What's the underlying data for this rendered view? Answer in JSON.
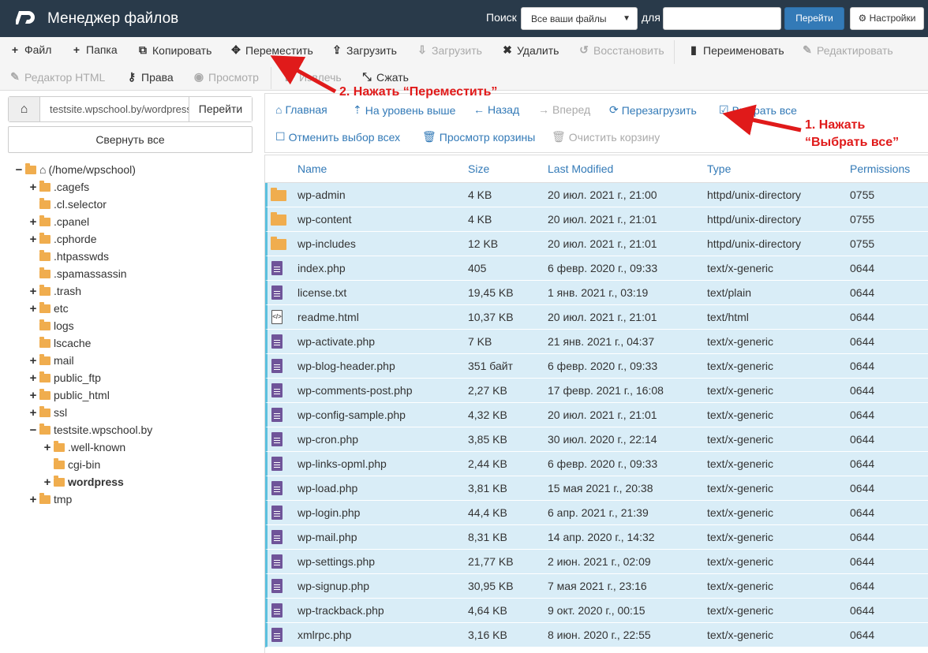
{
  "header": {
    "title": "Менеджер файлов",
    "search_label": "Поиск",
    "search_scope": "Все ваши файлы",
    "for_label": "для",
    "search_value": "",
    "go_label": "Перейти",
    "settings_label": "Настройки"
  },
  "toolbar": {
    "row1": [
      {
        "name": "file",
        "icon": "plus-icon",
        "glyph": "+",
        "label": "Файл",
        "enabled": true
      },
      {
        "name": "folder",
        "icon": "plus-icon",
        "glyph": "+",
        "label": "Папка",
        "enabled": true
      },
      {
        "name": "copy",
        "icon": "copy-icon",
        "glyph": "⧉",
        "label": "Копировать",
        "enabled": true
      },
      {
        "name": "move",
        "icon": "move-icon",
        "glyph": "✥",
        "label": "Переместить",
        "enabled": true
      },
      {
        "name": "upload",
        "icon": "upload-icon",
        "glyph": "⇪",
        "label": "Загрузить",
        "enabled": true
      },
      {
        "name": "download",
        "icon": "download-icon",
        "glyph": "⇩",
        "label": "Загрузить",
        "enabled": false
      },
      {
        "name": "delete",
        "icon": "close-icon",
        "glyph": "✖",
        "label": "Удалить",
        "enabled": true
      },
      {
        "name": "restore",
        "icon": "undo-icon",
        "glyph": "↺",
        "label": "Восстановить",
        "enabled": false
      },
      {
        "name": "rename",
        "icon": "file-icon",
        "glyph": "▮",
        "label": "Переименовать",
        "enabled": true
      },
      {
        "name": "edit",
        "icon": "pencil-icon",
        "glyph": "✎",
        "label": "Редактировать",
        "enabled": false
      }
    ],
    "row2": [
      {
        "name": "html-editor",
        "icon": "edit-icon",
        "glyph": "✎",
        "label": "Редактор HTML",
        "enabled": false
      },
      {
        "name": "permissions",
        "icon": "key-icon",
        "glyph": "⚷",
        "label": "Права",
        "enabled": true
      },
      {
        "name": "view",
        "icon": "eye-icon",
        "glyph": "◉",
        "label": "Просмотр",
        "enabled": false
      },
      {
        "name": "extract",
        "icon": "expand-icon",
        "glyph": "⤢",
        "label": "Извлечь",
        "enabled": false
      },
      {
        "name": "compress",
        "icon": "compress-icon",
        "glyph": "⤡",
        "label": "Сжать",
        "enabled": true
      }
    ]
  },
  "left": {
    "path_value": "testsite.wpschool.by/wordpress",
    "path_go": "Перейти",
    "collapse_label": "Свернуть все",
    "tree": [
      {
        "toggle": "−",
        "label": "(/home/wpschool)",
        "home": true,
        "indent": 0,
        "open": true
      },
      {
        "toggle": "+",
        "label": ".cagefs",
        "indent": 1
      },
      {
        "toggle": "",
        "label": ".cl.selector",
        "indent": 1
      },
      {
        "toggle": "+",
        "label": ".cpanel",
        "indent": 1
      },
      {
        "toggle": "+",
        "label": ".cphorde",
        "indent": 1
      },
      {
        "toggle": "",
        "label": ".htpasswds",
        "indent": 1
      },
      {
        "toggle": "",
        "label": ".spamassassin",
        "indent": 1
      },
      {
        "toggle": "+",
        "label": ".trash",
        "indent": 1
      },
      {
        "toggle": "+",
        "label": "etc",
        "indent": 1
      },
      {
        "toggle": "",
        "label": "logs",
        "indent": 1
      },
      {
        "toggle": "",
        "label": "lscache",
        "indent": 1
      },
      {
        "toggle": "+",
        "label": "mail",
        "indent": 1
      },
      {
        "toggle": "+",
        "label": "public_ftp",
        "indent": 1
      },
      {
        "toggle": "+",
        "label": "public_html",
        "indent": 1
      },
      {
        "toggle": "+",
        "label": "ssl",
        "indent": 1
      },
      {
        "toggle": "−",
        "label": "testsite.wpschool.by",
        "indent": 1,
        "open": true
      },
      {
        "toggle": "+",
        "label": ".well-known",
        "indent": 2
      },
      {
        "toggle": "",
        "label": "cgi-bin",
        "indent": 2
      },
      {
        "toggle": "+",
        "label": "wordpress",
        "indent": 2,
        "bold": true
      },
      {
        "toggle": "+",
        "label": "tmp",
        "indent": 1
      }
    ]
  },
  "nav": {
    "home": "Главная",
    "up": "На уровень выше",
    "back": "Назад",
    "forward": "Вперед",
    "reload": "Перезагрузить",
    "select_all": "Выбрать все",
    "deselect_all": "Отменить выбор всех",
    "view_trash": "Просмотр корзины",
    "empty_trash": "Очистить корзину"
  },
  "table": {
    "columns": [
      "Name",
      "Size",
      "Last Modified",
      "Type",
      "Permissions"
    ],
    "rows": [
      {
        "kind": "folder",
        "name": "wp-admin",
        "size": "4 KB",
        "modified": "20 июл. 2021 г., 21:00",
        "type": "httpd/unix-directory",
        "perm": "0755"
      },
      {
        "kind": "folder",
        "name": "wp-content",
        "size": "4 KB",
        "modified": "20 июл. 2021 г., 21:01",
        "type": "httpd/unix-directory",
        "perm": "0755"
      },
      {
        "kind": "folder",
        "name": "wp-includes",
        "size": "12 KB",
        "modified": "20 июл. 2021 г., 21:01",
        "type": "httpd/unix-directory",
        "perm": "0755"
      },
      {
        "kind": "file",
        "name": "index.php",
        "size": "405",
        "modified": "6 февр. 2020 г., 09:33",
        "type": "text/x-generic",
        "perm": "0644"
      },
      {
        "kind": "file",
        "name": "license.txt",
        "size": "19,45 KB",
        "modified": "1 янв. 2021 г., 03:19",
        "type": "text/plain",
        "perm": "0644"
      },
      {
        "kind": "html",
        "name": "readme.html",
        "size": "10,37 KB",
        "modified": "20 июл. 2021 г., 21:01",
        "type": "text/html",
        "perm": "0644"
      },
      {
        "kind": "file",
        "name": "wp-activate.php",
        "size": "7 KB",
        "modified": "21 янв. 2021 г., 04:37",
        "type": "text/x-generic",
        "perm": "0644"
      },
      {
        "kind": "file",
        "name": "wp-blog-header.php",
        "size": "351 байт",
        "modified": "6 февр. 2020 г., 09:33",
        "type": "text/x-generic",
        "perm": "0644"
      },
      {
        "kind": "file",
        "name": "wp-comments-post.php",
        "size": "2,27 KB",
        "modified": "17 февр. 2021 г., 16:08",
        "type": "text/x-generic",
        "perm": "0644"
      },
      {
        "kind": "file",
        "name": "wp-config-sample.php",
        "size": "4,32 KB",
        "modified": "20 июл. 2021 г., 21:01",
        "type": "text/x-generic",
        "perm": "0644"
      },
      {
        "kind": "file",
        "name": "wp-cron.php",
        "size": "3,85 KB",
        "modified": "30 июл. 2020 г., 22:14",
        "type": "text/x-generic",
        "perm": "0644"
      },
      {
        "kind": "file",
        "name": "wp-links-opml.php",
        "size": "2,44 KB",
        "modified": "6 февр. 2020 г., 09:33",
        "type": "text/x-generic",
        "perm": "0644"
      },
      {
        "kind": "file",
        "name": "wp-load.php",
        "size": "3,81 KB",
        "modified": "15 мая 2021 г., 20:38",
        "type": "text/x-generic",
        "perm": "0644"
      },
      {
        "kind": "file",
        "name": "wp-login.php",
        "size": "44,4 KB",
        "modified": "6 апр. 2021 г., 21:39",
        "type": "text/x-generic",
        "perm": "0644"
      },
      {
        "kind": "file",
        "name": "wp-mail.php",
        "size": "8,31 KB",
        "modified": "14 апр. 2020 г., 14:32",
        "type": "text/x-generic",
        "perm": "0644"
      },
      {
        "kind": "file",
        "name": "wp-settings.php",
        "size": "21,77 KB",
        "modified": "2 июн. 2021 г., 02:09",
        "type": "text/x-generic",
        "perm": "0644"
      },
      {
        "kind": "file",
        "name": "wp-signup.php",
        "size": "30,95 KB",
        "modified": "7 мая 2021 г., 23:16",
        "type": "text/x-generic",
        "perm": "0644"
      },
      {
        "kind": "file",
        "name": "wp-trackback.php",
        "size": "4,64 KB",
        "modified": "9 окт. 2020 г., 00:15",
        "type": "text/x-generic",
        "perm": "0644"
      },
      {
        "kind": "file",
        "name": "xmlrpc.php",
        "size": "3,16 KB",
        "modified": "8 июн. 2020 г., 22:55",
        "type": "text/x-generic",
        "perm": "0644"
      }
    ]
  },
  "annotations": {
    "step1_line1": "1. Нажать",
    "step1_line2": "“Выбрать все”",
    "step2": "2. Нажать “Переместить”",
    "color": "#e01a1a"
  },
  "colors": {
    "header_bg": "#293a4a",
    "accent": "#337ab7",
    "selected_row": "#d9edf7",
    "folder": "#f0ad4e",
    "file_icon": "#6f5499"
  }
}
